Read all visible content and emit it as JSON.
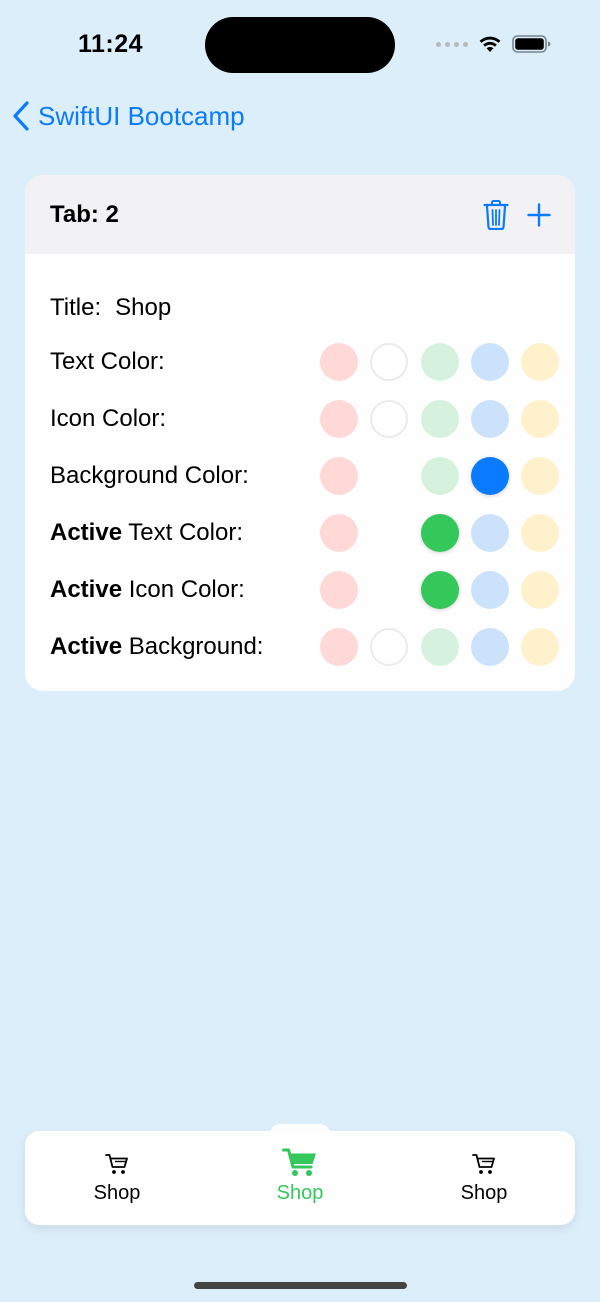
{
  "status_bar": {
    "time": "11:24"
  },
  "nav": {
    "back_label": "SwiftUI Bootcamp"
  },
  "card": {
    "title": "Tab: 2",
    "title_field": {
      "label": "Title:",
      "value": "Shop"
    },
    "palette": [
      "#FFD8D8",
      "#FFFFFF",
      "#D6F2DF",
      "#CCE2FB",
      "#FEF1CB"
    ],
    "rows": [
      {
        "bold": "",
        "label": "Text Color:",
        "swatches": [
          "#FFD8D8",
          "#FFFFFF",
          "#D6F2DF",
          "#CCE2FB",
          "#FEF1CB"
        ],
        "selected": null
      },
      {
        "bold": "",
        "label": "Icon Color:",
        "swatches": [
          "#FFD8D8",
          "#FFFFFF",
          "#D6F2DF",
          "#CCE2FB",
          "#FEF1CB"
        ],
        "selected": null
      },
      {
        "bold": "",
        "label": "Background Color:",
        "swatches": [
          "#FFD8D8",
          null,
          "#D6F2DF",
          "#0A7AFF",
          "#FEF1CB"
        ],
        "selected": 3
      },
      {
        "bold": "Active",
        "label": " Text Color:",
        "swatches": [
          "#FFD8D8",
          null,
          "#34C759",
          "#CCE2FB",
          "#FEF1CB"
        ],
        "selected": 2
      },
      {
        "bold": "Active",
        "label": " Icon Color:",
        "swatches": [
          "#FFD8D8",
          null,
          "#34C759",
          "#CCE2FB",
          "#FEF1CB"
        ],
        "selected": 2
      },
      {
        "bold": "Active",
        "label": " Background:",
        "swatches": [
          "#FFD8D8",
          "#FFFFFF",
          "#D6F2DF",
          "#CCE2FB",
          "#FEF1CB"
        ],
        "selected": null
      }
    ]
  },
  "tab_bar": {
    "tabs": [
      {
        "label": "Shop",
        "icon": "cart-icon",
        "active": false
      },
      {
        "label": "Shop",
        "icon": "cart-icon",
        "active": true
      },
      {
        "label": "Shop",
        "icon": "cart-icon",
        "active": false
      }
    ],
    "active_color": "#34C759",
    "inactive_color": "#000000"
  },
  "colors": {
    "accent": "#0A7AFF",
    "background": "#DCEEFA"
  }
}
